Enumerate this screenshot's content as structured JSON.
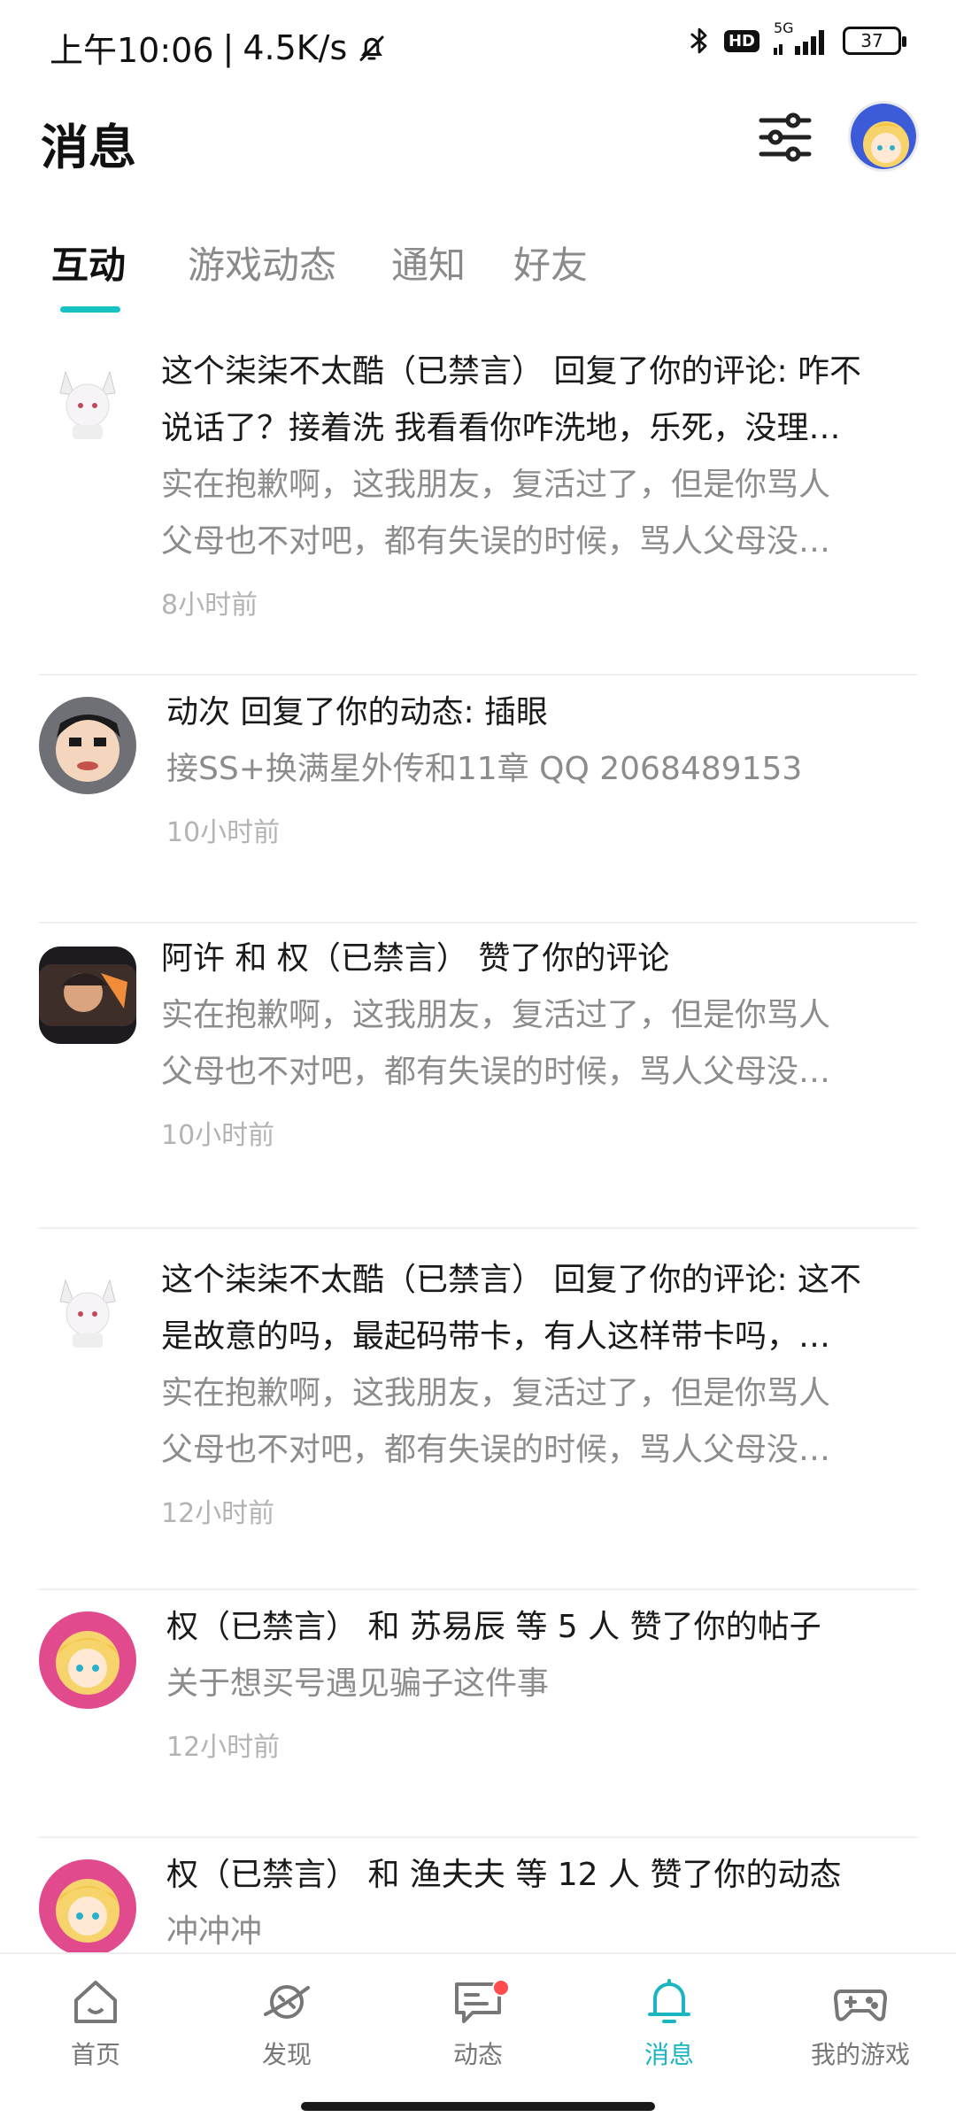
{
  "status_bar": {
    "time_text": "上午10:06",
    "network_speed": "4.5K/s",
    "net_type": "5G",
    "hd_badge": "HD",
    "battery": "37"
  },
  "header": {
    "title": "消息"
  },
  "tabs": [
    {
      "label": "互动",
      "active": true
    },
    {
      "label": "游戏动态",
      "active": false
    },
    {
      "label": "通知",
      "active": false
    },
    {
      "label": "好友",
      "active": false
    }
  ],
  "messages": [
    {
      "title_lines": [
        "这个柒柒不太酷（已禁言） 回复了你的评论: 咋不",
        "说话了？接着洗 我看看你咋洗地，乐死，没理…"
      ],
      "sub_lines": [
        "实在抱歉啊，这我朋友，复活过了，但是你骂人",
        "父母也不对吧，都有失误的时候，骂人父母没…"
      ],
      "time": "8小时前"
    },
    {
      "title_lines": [
        "动次 回复了你的动态: 插眼"
      ],
      "sub_lines": [
        "接SS+换满星外传和11章 QQ 2068489153"
      ],
      "time": "10小时前"
    },
    {
      "title_lines": [
        "阿许 和 权（已禁言） 赞了你的评论"
      ],
      "sub_lines": [
        "实在抱歉啊，这我朋友，复活过了，但是你骂人",
        "父母也不对吧，都有失误的时候，骂人父母没…"
      ],
      "time": "10小时前"
    },
    {
      "title_lines": [
        "这个柒柒不太酷（已禁言） 回复了你的评论: 这不",
        "是故意的吗，最起码带卡，有人这样带卡吗，…"
      ],
      "sub_lines": [
        "实在抱歉啊，这我朋友，复活过了，但是你骂人",
        "父母也不对吧，都有失误的时候，骂人父母没…"
      ],
      "time": "12小时前"
    },
    {
      "title_lines": [
        "权（已禁言） 和 苏易辰 等 5 人 赞了你的帖子"
      ],
      "sub_lines": [
        "关于想买号遇见骗子这件事"
      ],
      "time": "12小时前"
    },
    {
      "title_lines": [
        "权（已禁言） 和 渔夫夫 等 12 人 赞了你的动态"
      ],
      "sub_lines": [
        "冲冲冲"
      ],
      "time": ""
    }
  ],
  "bottom_nav": [
    {
      "label": "首页",
      "icon": "home-icon"
    },
    {
      "label": "发现",
      "icon": "planet-icon"
    },
    {
      "label": "动态",
      "icon": "chat-icon",
      "badge": true
    },
    {
      "label": "消息",
      "icon": "bell-icon",
      "active": true
    },
    {
      "label": "我的游戏",
      "icon": "gamepad-icon"
    }
  ],
  "colors": {
    "accent": "#16c2c3",
    "active_nav": "#19b6c1",
    "badge": "#ff4d4f",
    "secondary_text": "#8c8c8c",
    "time_text": "#b3b3b3"
  }
}
